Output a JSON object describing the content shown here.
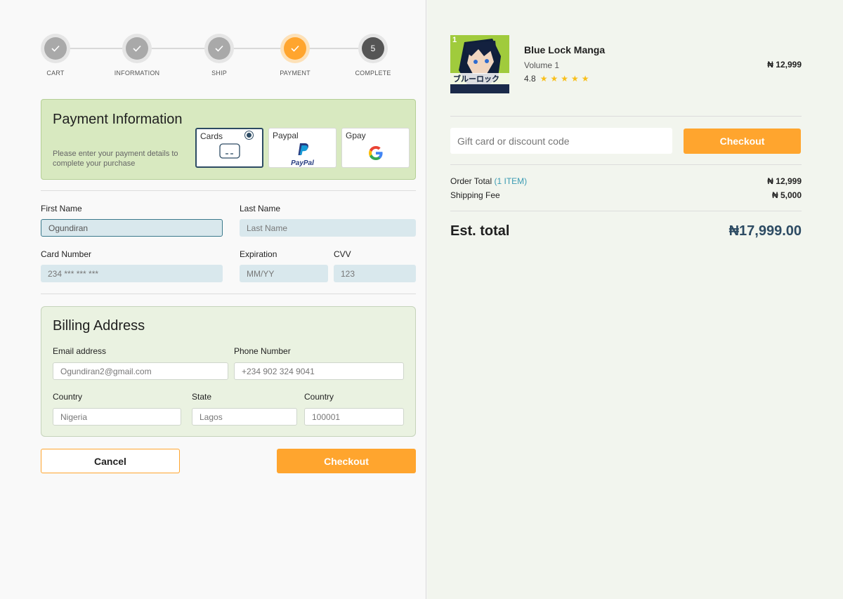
{
  "stepper": {
    "steps": [
      {
        "label": "CART",
        "state": "done"
      },
      {
        "label": "INFORMATION",
        "state": "done"
      },
      {
        "label": "SHIP",
        "state": "done"
      },
      {
        "label": "PAYMENT",
        "state": "active"
      },
      {
        "label": "COMPLETE",
        "state": "next",
        "number": "5"
      }
    ]
  },
  "payment": {
    "title": "Payment Information",
    "subtitle": "Please enter your payment details to complete your purchase",
    "methods": [
      {
        "label": "Cards",
        "icon": "credit-card-icon",
        "selected": true
      },
      {
        "label": "Paypal",
        "icon": "paypal-logo",
        "logo_text": "PayPal"
      },
      {
        "label": "Gpay",
        "icon": "google-g-logo"
      }
    ]
  },
  "card_form": {
    "first_name_label": "First Name",
    "first_name_value": "Ogundiran",
    "last_name_label": "Last Name",
    "last_name_placeholder": "Last Name",
    "card_number_label": "Card Number",
    "card_number_placeholder": "234 *** *** ***",
    "expiration_label": "Expiration",
    "expiration_placeholder": "MM/YY",
    "cvv_label": "CVV",
    "cvv_placeholder": "123"
  },
  "billing": {
    "title": "Billing Address",
    "email_label": "Email address",
    "email_value": "Ogundiran2@gmail.com",
    "phone_label": "Phone Number",
    "phone_value": "+234 902 324 9041",
    "country_label": "Country",
    "country_value": "Nigeria",
    "state_label": "State",
    "state_value": "Lagos",
    "postal_label": "Country",
    "postal_value": "100001"
  },
  "actions": {
    "cancel_label": "Cancel",
    "checkout_label": "Checkout"
  },
  "summary": {
    "product": {
      "title": "Blue Lock Manga",
      "volume": "Volume 1",
      "rating": "4.8",
      "stars": "★★★★★",
      "price": "₦ 12,999",
      "cover_number": "1"
    },
    "gift_placeholder": "Gift card or discount code",
    "checkout_label": "Checkout",
    "order_total_label": "Order Total",
    "order_total_note": "(1 ITEM)",
    "order_total_value": "₦ 12,999",
    "shipping_label": "Shipping Fee",
    "shipping_value": "₦ 5,000",
    "est_label": "Est. total",
    "est_value": "₦17,999.00"
  },
  "colors": {
    "accent": "#ffa52e",
    "navy": "#2d4b63",
    "payment_box_bg": "#d8e9c0",
    "billing_box_bg": "#eaf2e1"
  }
}
